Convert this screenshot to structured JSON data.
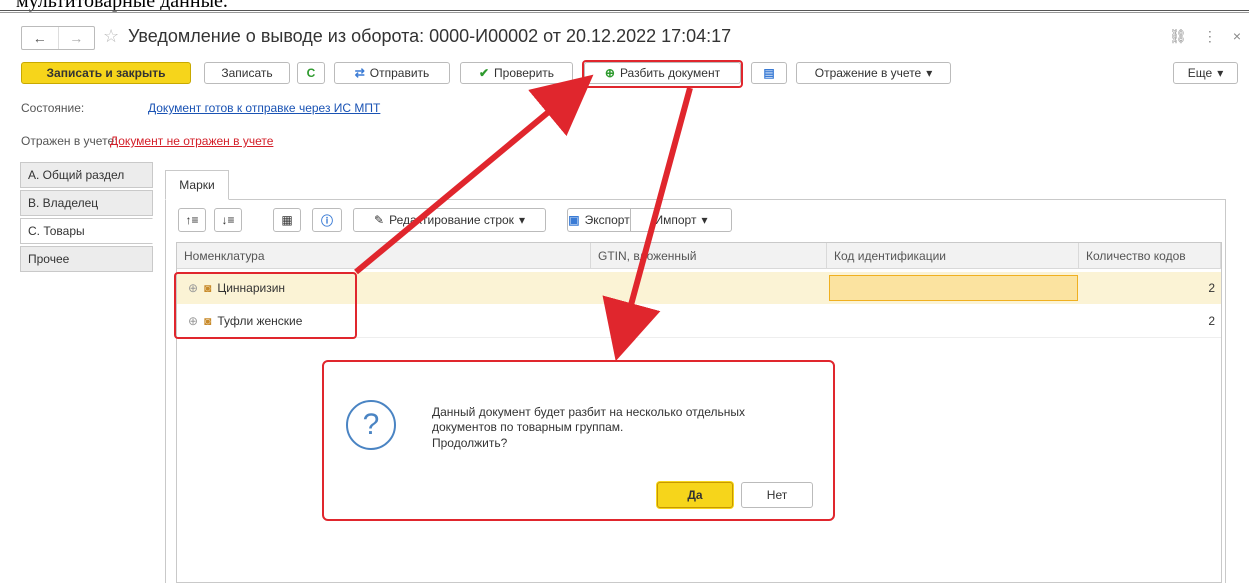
{
  "caption": "мультитоварные данные.",
  "window": {
    "title": "Уведомление о выводе из оборота: 0000-И00002 от 20.12.2022 17:04:17",
    "nav_back": "←",
    "nav_forward": "→",
    "star": "☆",
    "link_icon": "⛓",
    "menu_icon": "⋮",
    "close_icon": "×"
  },
  "toolbar": {
    "save_close": "Записать и закрыть",
    "save": "Записать",
    "refresh_icon": "C",
    "send": "Отправить",
    "check": "Проверить",
    "split": "Разбить документ",
    "accounting": "Отражение в учете",
    "more": "Еще"
  },
  "status": {
    "state_label": "Состояние:",
    "state_value": "Документ готов к отправке через ИС МПТ",
    "reflected_label": "Отражен в учете:",
    "reflected_value": "Документ не отражен в учете"
  },
  "side_tabs": [
    "А. Общий раздел",
    "В. Владелец",
    "С. Товары",
    "Прочее"
  ],
  "inner_tab": "Марки",
  "grid_toolbar": {
    "edit_rows": "Редактирование строк",
    "export": "Экспорт",
    "import": "Импорт"
  },
  "grid": {
    "columns": [
      "Номенклатура",
      "GTIN, вложенный",
      "Код идентификации",
      "Количество кодов"
    ],
    "rows": [
      {
        "name": "Циннаризин",
        "gtin": "",
        "code": "",
        "count": "2"
      },
      {
        "name": "Туфли женские",
        "gtin": "",
        "code": "",
        "count": "2"
      }
    ]
  },
  "dialog": {
    "line1": "Данный документ будет разбит на несколько отдельных",
    "line2": "документов по товарным группам.",
    "line3": "Продолжить?",
    "yes": "Да",
    "no": "Нет"
  },
  "colors": {
    "accent_yellow": "#f6d51b",
    "annotation_red": "#e0262d",
    "link_blue": "#1a53b4",
    "link_red": "#d4202a"
  }
}
